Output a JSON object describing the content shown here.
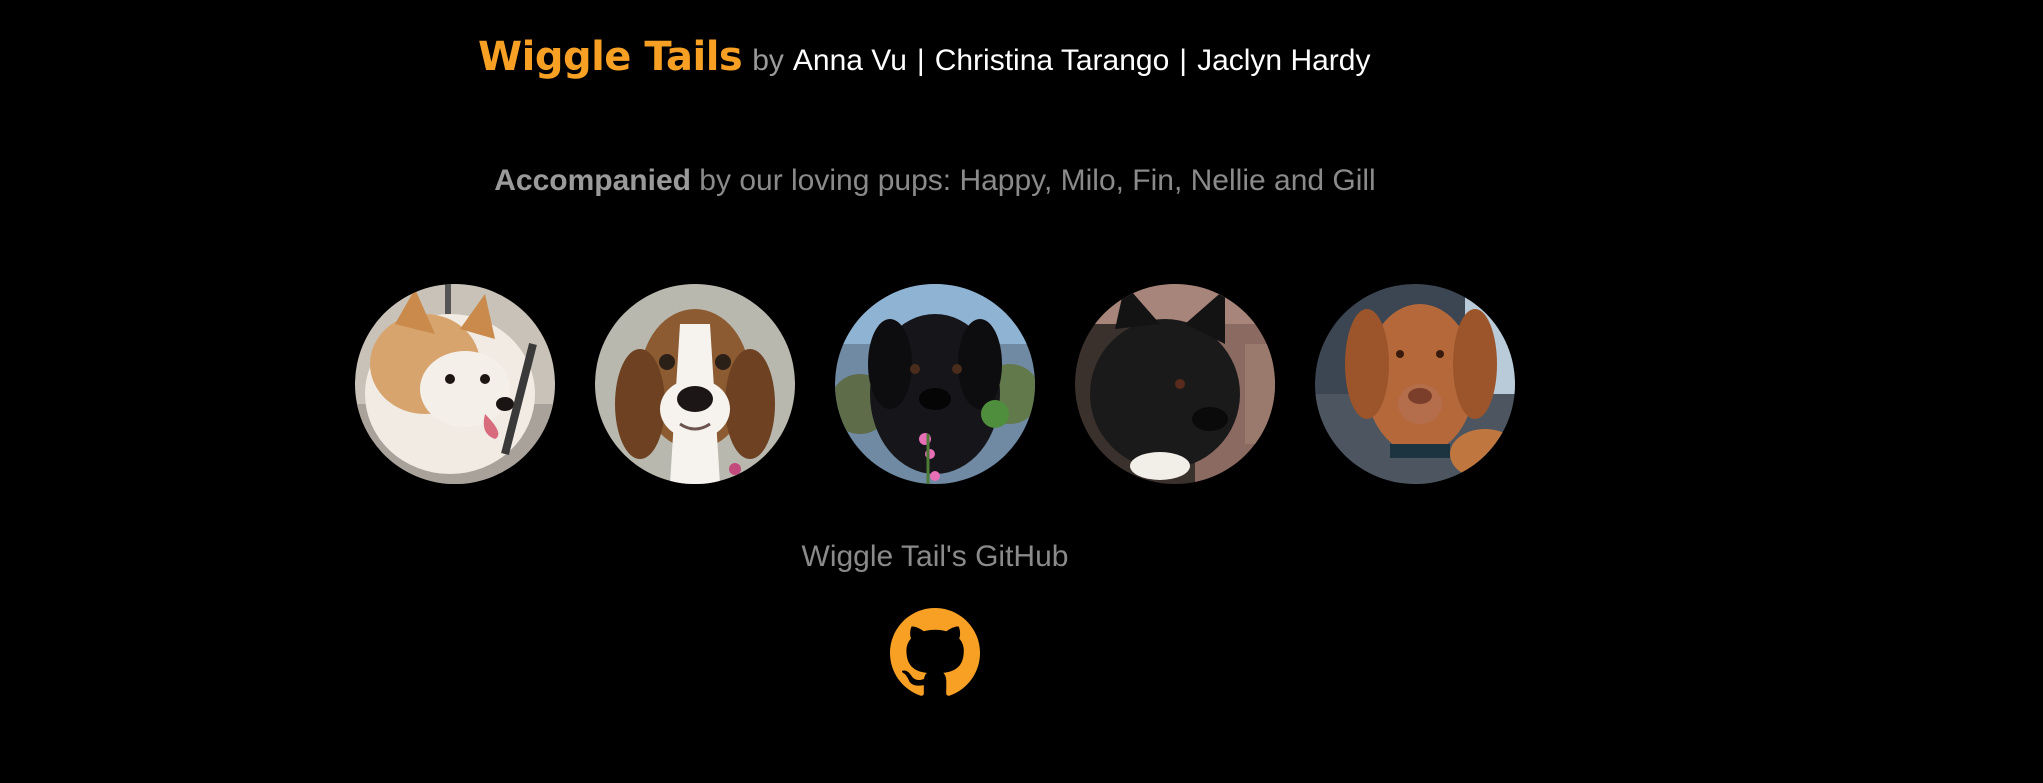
{
  "header": {
    "brand": "Wiggle Tails",
    "by": "by",
    "authors": [
      "Anna Vu",
      "Christina Tarango",
      "Jaclyn Hardy"
    ],
    "separator": "|"
  },
  "accompanied": {
    "strong": "Accompanied",
    "rest": " by our loving pups: Happy, Milo, Fin, Nellie and Gill"
  },
  "pups": [
    {
      "name": "Happy"
    },
    {
      "name": "Milo"
    },
    {
      "name": "Fin"
    },
    {
      "name": "Nellie"
    },
    {
      "name": "Gill"
    }
  ],
  "github": {
    "label": "Wiggle Tail's GitHub",
    "icon": "github-icon"
  },
  "colors": {
    "background": "#000000",
    "brand": "#f7a024",
    "muted_text": "#8a8a8a",
    "white_text": "#ffffff"
  }
}
